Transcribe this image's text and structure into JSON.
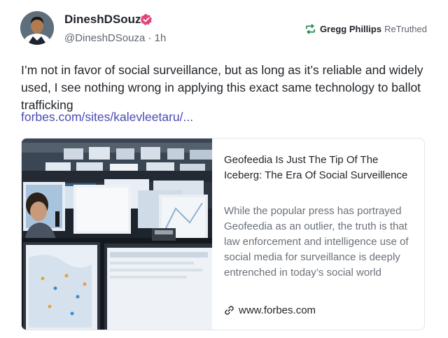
{
  "post": {
    "author": {
      "display_name": "DineshDSouza",
      "handle": "@DineshDSouza",
      "separator": "·",
      "time_ago": "1h",
      "verified": true,
      "avatar": "portrait-avatar"
    },
    "retruth": {
      "icon": "retruth-icon",
      "name": "Gregg Phillips",
      "action": "ReTruthed"
    },
    "text": "I’m not in favor of social surveillance, but as long as it’s reliable and widely used, I see nothing wrong in applying this exact same technology to ballot trafficking",
    "link_text": "forbes.com/sites/kalevleetaru/..."
  },
  "card": {
    "image": "monitoring-center-photo",
    "title": "Geofeedia Is Just The Tip Of The Iceberg: The Era Of Social Surveillence",
    "description": "While the popular press has portrayed Geofeedia as an outlier, the truth is that law enforcement and intelligence use of social media for surveillance is deeply entrenched in today’s social world",
    "domain": "www.forbes.com",
    "domain_icon": "link-icon"
  },
  "colors": {
    "text": "#1f2328",
    "muted": "#606770",
    "link": "#4b4bb5",
    "verified": "#e0457b",
    "retruth_icon": "#1f8a4c",
    "card_border": "#e3e5e8"
  }
}
